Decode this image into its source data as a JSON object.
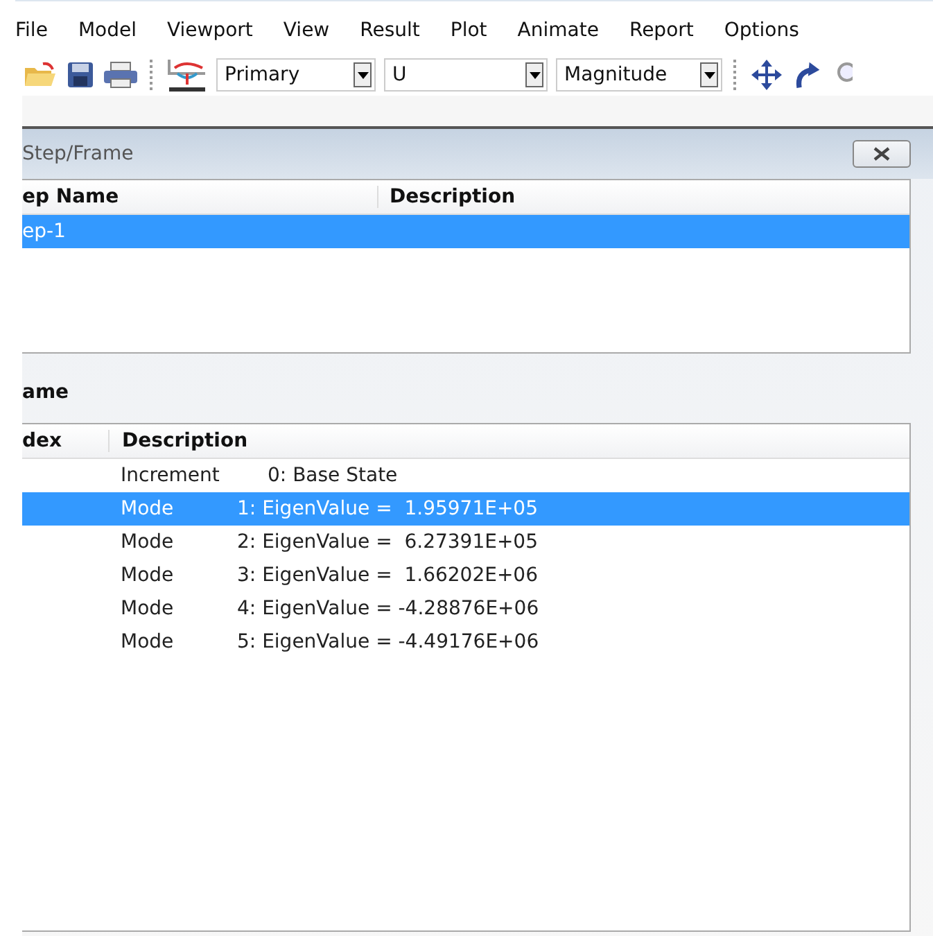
{
  "menu": [
    "File",
    "Model",
    "Viewport",
    "View",
    "Result",
    "Plot",
    "Animate",
    "Report",
    "Options"
  ],
  "toolbar": {
    "combos": [
      {
        "value": "Primary"
      },
      {
        "value": "U"
      },
      {
        "value": "Magnitude"
      }
    ]
  },
  "dialog": {
    "title": "Step/Frame",
    "step_table": {
      "columns": [
        "ep Name",
        "Description"
      ],
      "rows": [
        {
          "name": "ep-1",
          "selected": true
        }
      ]
    },
    "frame_label": "ame",
    "frame_table": {
      "columns": [
        "dex",
        "Description"
      ],
      "rows": [
        {
          "type": "Increment",
          "detail": "0: Base State",
          "selected": false
        },
        {
          "type": "Mode",
          "detail": "1: EigenValue =  1.95971E+05",
          "selected": true
        },
        {
          "type": "Mode",
          "detail": "2: EigenValue =  6.27391E+05",
          "selected": false
        },
        {
          "type": "Mode",
          "detail": "3: EigenValue =  1.66202E+06",
          "selected": false
        },
        {
          "type": "Mode",
          "detail": "4: EigenValue = -4.28876E+06",
          "selected": false
        },
        {
          "type": "Mode",
          "detail": "5: EigenValue = -4.49176E+06",
          "selected": false
        }
      ]
    }
  }
}
